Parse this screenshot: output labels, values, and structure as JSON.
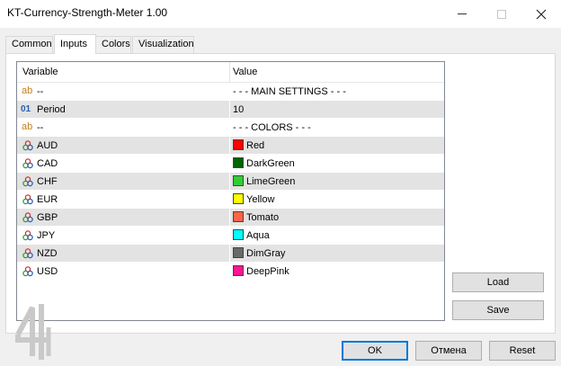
{
  "window": {
    "title": "KT-Currency-Strength-Meter 1.00"
  },
  "tabs": [
    "Common",
    "Inputs",
    "Colors",
    "Visualization"
  ],
  "grid": {
    "headers": {
      "variable": "Variable",
      "value": "Value"
    },
    "rows": [
      {
        "icon": "ab",
        "name": "--",
        "value": "- - - MAIN SETTINGS - - -"
      },
      {
        "icon": "01",
        "name": "Period",
        "value": "10"
      },
      {
        "icon": "ab",
        "name": "--",
        "value": "- - - COLORS - - -"
      },
      {
        "icon": "palette",
        "name": "AUD",
        "value": "Red",
        "color": "#ff0000"
      },
      {
        "icon": "palette",
        "name": "CAD",
        "value": "DarkGreen",
        "color": "#006400"
      },
      {
        "icon": "palette",
        "name": "CHF",
        "value": "LimeGreen",
        "color": "#32cd32"
      },
      {
        "icon": "palette",
        "name": "EUR",
        "value": "Yellow",
        "color": "#ffff00"
      },
      {
        "icon": "palette",
        "name": "GBP",
        "value": "Tomato",
        "color": "#ff6347"
      },
      {
        "icon": "palette",
        "name": "JPY",
        "value": "Aqua",
        "color": "#00ffff"
      },
      {
        "icon": "palette",
        "name": "NZD",
        "value": "DimGray",
        "color": "#696969"
      },
      {
        "icon": "palette",
        "name": "USD",
        "value": "DeepPink",
        "color": "#ff1493"
      }
    ]
  },
  "buttons": {
    "load": "Load",
    "save": "Save",
    "ok": "OK",
    "cancel": "Отмена",
    "reset": "Reset"
  }
}
